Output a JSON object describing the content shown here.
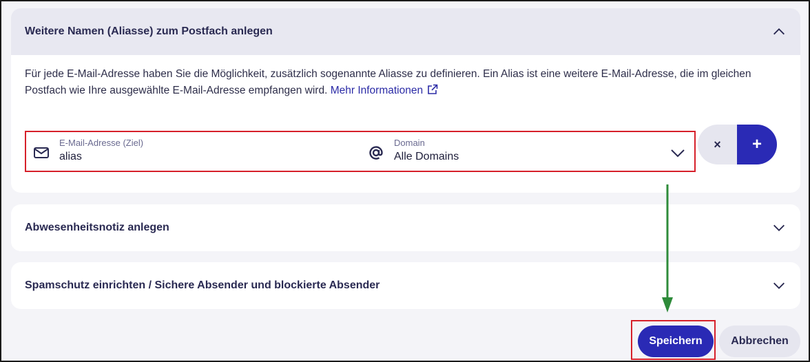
{
  "alias_section": {
    "title": "Weitere Namen (Aliasse) zum Postfach anlegen",
    "description": "Für jede E-Mail-Adresse haben Sie die Möglichkeit, zusätzlich sogenannte Aliasse zu definieren. Ein Alias ist eine weitere E-Mail-Adresse, die im gleichen Postfach wie Ihre ausgewählte E-Mail-Adresse empfangen wird.",
    "more_info_link": "Mehr Informationen",
    "email_field": {
      "label": "E-Mail-Adresse (Ziel)",
      "value": "alias"
    },
    "domain_field": {
      "label": "Domain",
      "value": "Alle Domains"
    },
    "remove_label": "×",
    "add_label": "+"
  },
  "absence_section": {
    "title": "Abwesenheitsnotiz anlegen"
  },
  "spam_section": {
    "title": "Spamschutz einrichten / Sichere Absender und blockierte Absender"
  },
  "actions": {
    "save_label": "Speichern",
    "cancel_label": "Abbrechen"
  },
  "colors": {
    "primary": "#2a2ab5",
    "highlight_border": "#d6202a",
    "annotation_arrow": "#2e8b3a",
    "header_bg": "#e8e8f1",
    "page_bg": "#f4f4f8"
  },
  "icons": {
    "expanded": "chevron-up-icon",
    "collapsed": "chevron-down-icon",
    "email": "envelope-icon",
    "domain": "at-sign-icon",
    "external": "external-link-icon"
  }
}
